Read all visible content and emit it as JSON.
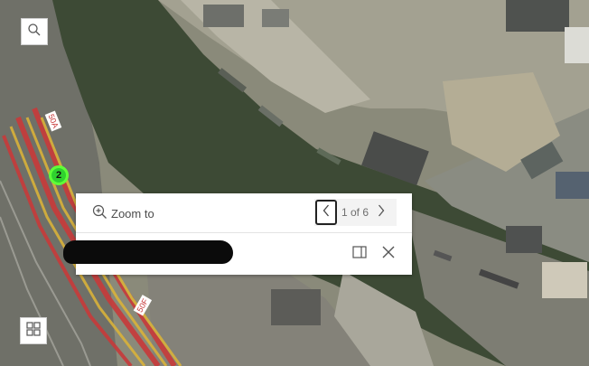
{
  "map": {
    "cluster_count": "2",
    "track_labels": [
      "50A",
      "50F"
    ]
  },
  "controls": {
    "search_icon": "search-icon",
    "basemap_icon": "basemap-gallery-icon"
  },
  "popup": {
    "zoom_to_label": "Zoom to",
    "pager_text": "1 of 6",
    "title": "",
    "icons": [
      "zoom-in-icon",
      "chevron-left-icon",
      "chevron-right-icon",
      "dock-icon",
      "close-icon"
    ]
  },
  "colors": {
    "cluster_fill": "#2fd12f",
    "cluster_ring": "#5fff38",
    "water": "#3d4a35",
    "rail_red": "#c83a3a",
    "rail_yellow": "#d9b23a"
  }
}
